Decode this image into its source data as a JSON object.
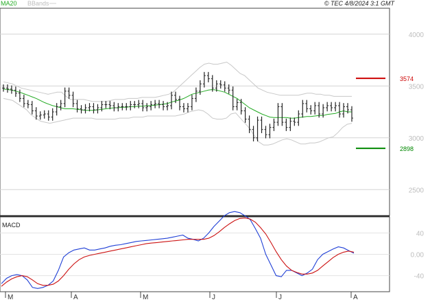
{
  "header": {
    "legend_ma": "MA20",
    "legend_bbands": "BBands",
    "copyright": "© TEC 4/8/2024 3:1 GMT"
  },
  "colors": {
    "price": "#222222",
    "ma": "#22aa22",
    "bands": "#c8c8c8",
    "resistance": "#cc0000",
    "support": "#008800",
    "macd": "#1f3fd6",
    "signal": "#cc1111"
  },
  "chart_data": [
    {
      "type": "line",
      "title": "",
      "ylim": [
        2250,
        4250
      ],
      "yticks": [
        {
          "label": "4000",
          "value": 4000
        },
        {
          "label": "3500",
          "value": 3500
        },
        {
          "label": "3000",
          "value": 3000
        },
        {
          "label": "2500",
          "value": 2500
        }
      ],
      "months": [
        "M",
        "A",
        "M",
        "J",
        "J",
        "A"
      ],
      "levels": [
        {
          "name": "resistance",
          "value": 3574,
          "label": "3574"
        },
        {
          "name": "support",
          "value": 2898,
          "label": "2898"
        }
      ],
      "series": [
        {
          "name": "price",
          "style": "ohlc",
          "values": [
            3480,
            3470,
            3460,
            3430,
            3380,
            3330,
            3320,
            3260,
            3210,
            3220,
            3230,
            3200,
            3250,
            3300,
            3330,
            3450,
            3410,
            3330,
            3280,
            3270,
            3290,
            3300,
            3270,
            3290,
            3320,
            3320,
            3310,
            3290,
            3300,
            3300,
            3300,
            3320,
            3320,
            3330,
            3290,
            3300,
            3320,
            3330,
            3320,
            3300,
            3310,
            3410,
            3370,
            3300,
            3280,
            3300,
            3380,
            3450,
            3520,
            3600,
            3570,
            3480,
            3520,
            3510,
            3480,
            3460,
            3300,
            3340,
            3260,
            3180,
            3080,
            3000,
            3170,
            3080,
            3030,
            3100,
            3150,
            3300,
            3150,
            3100,
            3160,
            3150,
            3230,
            3330,
            3280,
            3260,
            3310,
            3230,
            3290,
            3310,
            3290,
            3310,
            3230,
            3300,
            3270,
            3190
          ]
        },
        {
          "name": "MA20",
          "values": [
            3470,
            3465,
            3460,
            3450,
            3440,
            3425,
            3410,
            3395,
            3380,
            3360,
            3340,
            3325,
            3310,
            3300,
            3290,
            3280,
            3280,
            3280,
            3275,
            3270,
            3265,
            3265,
            3265,
            3270,
            3275,
            3280,
            3285,
            3290,
            3290,
            3295,
            3295,
            3300,
            3300,
            3305,
            3305,
            3310,
            3310,
            3315,
            3320,
            3325,
            3330,
            3345,
            3355,
            3365,
            3380,
            3400,
            3420,
            3430,
            3440,
            3450,
            3460,
            3465,
            3460,
            3450,
            3440,
            3420,
            3400,
            3380,
            3350,
            3320,
            3290,
            3270,
            3250,
            3230,
            3215,
            3200,
            3195,
            3195,
            3195,
            3195,
            3190,
            3190,
            3195,
            3200,
            3205,
            3205,
            3210,
            3215,
            3215,
            3225,
            3230,
            3235,
            3250,
            3260,
            3250,
            3250
          ]
        },
        {
          "name": "upper_band",
          "values": [
            3540,
            3530,
            3520,
            3500,
            3480,
            3470,
            3460,
            3450,
            3440,
            3430,
            3420,
            3430,
            3440,
            3440,
            3400,
            3370,
            3370,
            3370,
            3370,
            3360,
            3350,
            3350,
            3350,
            3350,
            3360,
            3370,
            3370,
            3370,
            3380,
            3380,
            3380,
            3390,
            3390,
            3390,
            3390,
            3400,
            3410,
            3420,
            3440,
            3480,
            3520,
            3560,
            3600,
            3640,
            3680,
            3710,
            3720,
            3710,
            3710,
            3720,
            3730,
            3700,
            3660,
            3620,
            3600,
            3560,
            3520,
            3480,
            3460,
            3440,
            3430,
            3420,
            3410,
            3410,
            3410,
            3410,
            3410,
            3420,
            3430,
            3430,
            3420,
            3420,
            3410,
            3410,
            3400,
            3400,
            3400,
            3400,
            3400
          ]
        },
        {
          "name": "lower_band",
          "values": [
            3380,
            3370,
            3360,
            3330,
            3300,
            3270,
            3220,
            3190,
            3160,
            3150,
            3140,
            3150,
            3160,
            3170,
            3180,
            3190,
            3190,
            3190,
            3190,
            3190,
            3180,
            3180,
            3180,
            3180,
            3180,
            3190,
            3190,
            3190,
            3200,
            3200,
            3200,
            3210,
            3210,
            3210,
            3210,
            3210,
            3210,
            3210,
            3220,
            3230,
            3250,
            3260,
            3270,
            3260,
            3230,
            3190,
            3180,
            3180,
            3190,
            3230,
            3240,
            3190,
            3140,
            3090,
            3020,
            2960,
            2930,
            2930,
            2940,
            2960,
            2980,
            2990,
            2980,
            2960,
            2940,
            2940,
            2950,
            2950,
            2960,
            2980,
            3000,
            3010,
            3050,
            3100,
            3130,
            3140
          ]
        }
      ]
    },
    {
      "type": "line",
      "title": "MACD",
      "ylim": [
        -70,
        70
      ],
      "yticks": [
        {
          "label": "40",
          "value": 40
        },
        {
          "label": "0.00",
          "value": 0
        },
        {
          "label": "-40",
          "value": -40
        }
      ],
      "series": [
        {
          "name": "MACD",
          "values": [
            -55,
            -45,
            -40,
            -38,
            -40,
            -48,
            -62,
            -64,
            -62,
            -58,
            -50,
            -30,
            -5,
            3,
            8,
            10,
            12,
            8,
            8,
            10,
            12,
            15,
            17,
            18,
            20,
            22,
            24,
            25,
            26,
            27,
            28,
            29,
            30,
            32,
            34,
            36,
            30,
            28,
            25,
            30,
            40,
            52,
            62,
            72,
            78,
            80,
            78,
            72,
            65,
            48,
            30,
            0,
            -20,
            -40,
            -42,
            -30,
            -30,
            -35,
            -40,
            -35,
            -28,
            -10,
            0,
            5,
            10,
            14,
            12,
            7,
            2
          ]
        },
        {
          "name": "Signal",
          "values": [
            -60,
            -52,
            -46,
            -42,
            -40,
            -42,
            -48,
            -55,
            -58,
            -58,
            -56,
            -50,
            -40,
            -28,
            -18,
            -10,
            -5,
            -2,
            0,
            2,
            4,
            6,
            8,
            10,
            12,
            14,
            16,
            18,
            20,
            21,
            22,
            23,
            24,
            25,
            26,
            27,
            28,
            28,
            28,
            28,
            30,
            35,
            42,
            50,
            57,
            63,
            67,
            68,
            66,
            60,
            50,
            38,
            22,
            5,
            -10,
            -22,
            -30,
            -34,
            -37,
            -37,
            -35,
            -30,
            -22,
            -14,
            -6,
            0,
            4,
            6,
            4
          ]
        }
      ]
    }
  ]
}
